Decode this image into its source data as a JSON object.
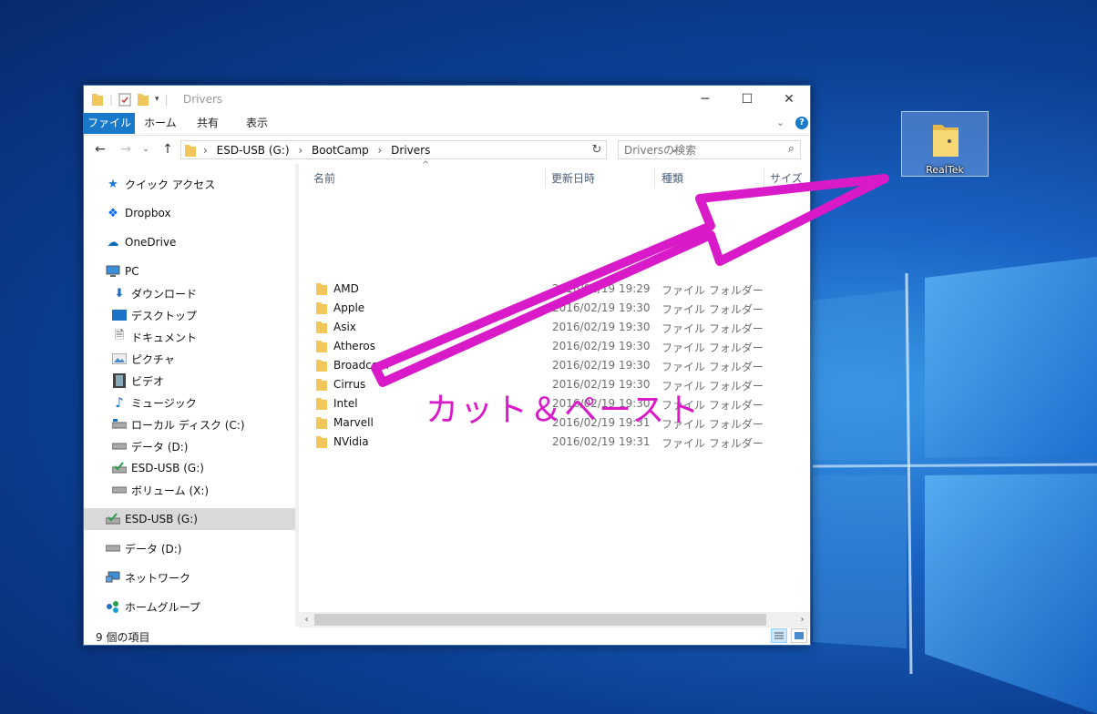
{
  "desktop": {
    "icon_label": "RealTek",
    "accent": "#1979ca"
  },
  "window": {
    "title": "Drivers",
    "tabs": [
      "ファイル",
      "ホーム",
      "共有",
      "表示"
    ],
    "breadcrumb": [
      "ESD-USB (G:)",
      "BootCamp",
      "Drivers"
    ],
    "search_placeholder": "Driversの検索"
  },
  "nav": [
    {
      "label": "クイック アクセス",
      "icon": "star-icon"
    },
    {
      "label": "Dropbox",
      "icon": "dropbox-icon"
    },
    {
      "label": "OneDrive",
      "icon": "cloud-icon"
    },
    {
      "label": "PC",
      "icon": "monitor-icon"
    },
    {
      "label": "ダウンロード",
      "icon": "download-icon"
    },
    {
      "label": "デスクトップ",
      "icon": "desktop-icon"
    },
    {
      "label": "ドキュメント",
      "icon": "document-icon"
    },
    {
      "label": "ピクチャ",
      "icon": "picture-icon"
    },
    {
      "label": "ビデオ",
      "icon": "video-icon"
    },
    {
      "label": "ミュージック",
      "icon": "music-icon"
    },
    {
      "label": "ローカル ディスク (C:)",
      "icon": "drive-icon"
    },
    {
      "label": "データ (D:)",
      "icon": "drive-icon"
    },
    {
      "label": "ESD-USB (G:)",
      "icon": "usb-drive-icon"
    },
    {
      "label": "ボリューム (X:)",
      "icon": "drive-icon"
    },
    {
      "label": "ESD-USB (G:)",
      "icon": "usb-drive-icon"
    },
    {
      "label": "データ (D:)",
      "icon": "drive-icon"
    },
    {
      "label": "ネットワーク",
      "icon": "network-icon"
    },
    {
      "label": "ホームグループ",
      "icon": "homegroup-icon"
    }
  ],
  "columns": [
    "名前",
    "更新日時",
    "種類",
    "サイズ"
  ],
  "files": [
    {
      "name": "AMD",
      "date": "2016/02/19 19:29",
      "type": "ファイル フォルダー"
    },
    {
      "name": "Apple",
      "date": "2016/02/19 19:30",
      "type": "ファイル フォルダー"
    },
    {
      "name": "Asix",
      "date": "2016/02/19 19:30",
      "type": "ファイル フォルダー"
    },
    {
      "name": "Atheros",
      "date": "2016/02/19 19:30",
      "type": "ファイル フォルダー"
    },
    {
      "name": "Broadcom",
      "date": "2016/02/19 19:30",
      "type": "ファイル フォルダー"
    },
    {
      "name": "Cirrus",
      "date": "2016/02/19 19:30",
      "type": "ファイル フォルダー"
    },
    {
      "name": "Intel",
      "date": "2016/02/19 19:30",
      "type": "ファイル フォルダー"
    },
    {
      "name": "Marvell",
      "date": "2016/02/19 19:31",
      "type": "ファイル フォルダー"
    },
    {
      "name": "NVidia",
      "date": "2016/02/19 19:31",
      "type": "ファイル フォルダー"
    }
  ],
  "status": "9 個の項目",
  "annotation": {
    "text": "カット＆ペースト",
    "color": "#d91ac8"
  }
}
